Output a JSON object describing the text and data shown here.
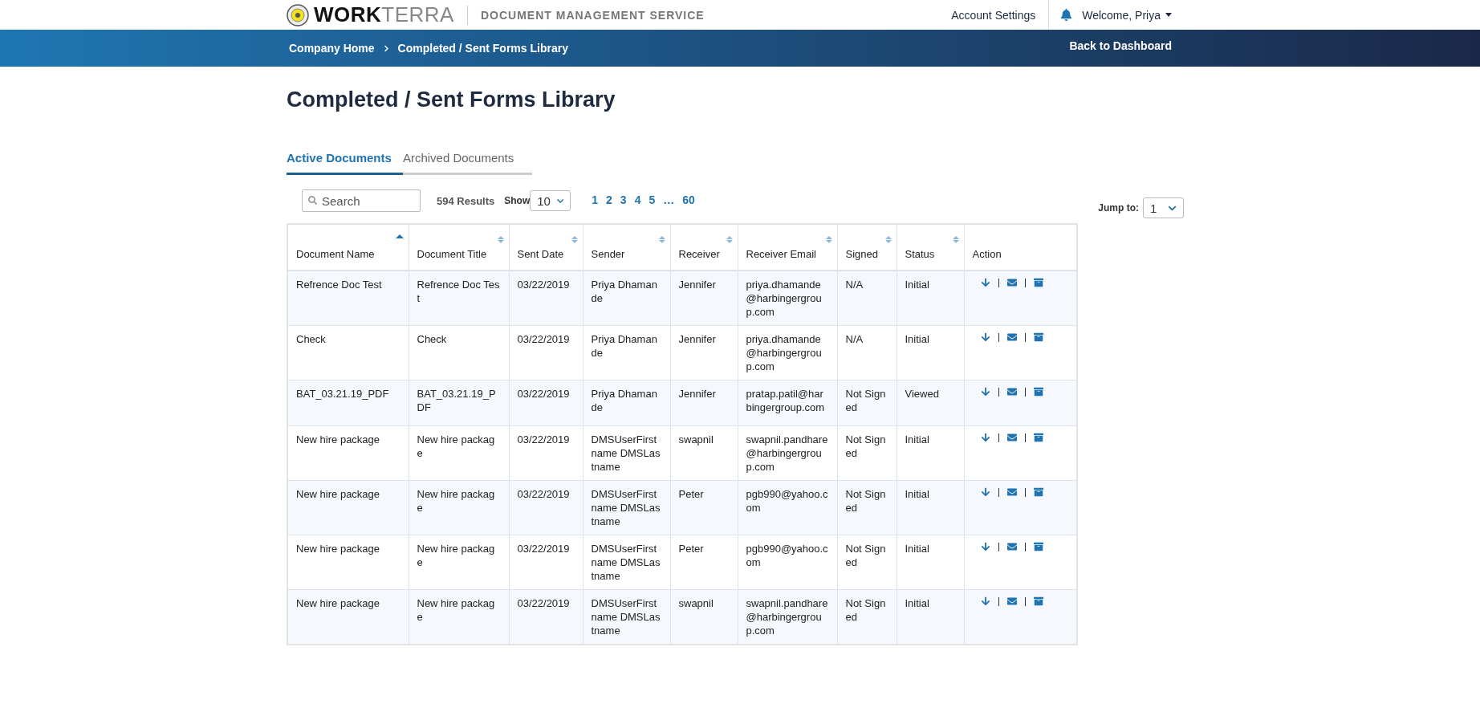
{
  "header": {
    "logo": "**WORK**TERRA",
    "service": "DOCUMENT MANAGEMENT SERVICE",
    "account_settings": "Account Settings",
    "welcome": "Welcome, Priya"
  },
  "breadcrumb": {
    "items": [
      "Company Home",
      "Completed / Sent Forms Library"
    ],
    "back": "Back to Dashboard"
  },
  "page_title": "Completed / Sent Forms Library",
  "tabs": [
    {
      "label": "Active Documents",
      "selected": true
    },
    {
      "label": "Archived Documents",
      "selected": false
    }
  ],
  "toolbar": {
    "search_placeholder": "Search",
    "results": "594 Results",
    "show_label": "Show",
    "show_value": "10",
    "pages": [
      "1",
      "2",
      "3",
      "4",
      "5",
      "…",
      "60"
    ],
    "jump_label": "Jump to:",
    "jump_value": "1"
  },
  "table": {
    "columns": [
      {
        "label": "Document Name",
        "sortable": true,
        "sorted": true
      },
      {
        "label": "Document Title",
        "sortable": true,
        "sorted": false
      },
      {
        "label": "Sent Date",
        "sortable": true,
        "sorted": false
      },
      {
        "label": "Sender",
        "sortable": true,
        "sorted": false
      },
      {
        "label": "Receiver",
        "sortable": true,
        "sorted": false
      },
      {
        "label": "Receiver Email",
        "sortable": true,
        "sorted": false
      },
      {
        "label": "Signed",
        "sortable": true,
        "sorted": false
      },
      {
        "label": "Status",
        "sortable": true,
        "sorted": false
      },
      {
        "label": "Action",
        "sortable": false
      }
    ],
    "rows": [
      [
        "Refrence Doc Test",
        "Refrence Doc Test",
        "03/22/2019",
        "Priya Dhamande",
        "Jennifer",
        "priya.dhamande@harbingergroup.com",
        "N/A",
        "Initial"
      ],
      [
        "Check",
        "Check",
        "03/22/2019",
        "Priya Dhamande",
        "Jennifer",
        "priya.dhamande@harbingergroup.com",
        "N/A",
        "Initial"
      ],
      [
        "BAT_03.21.19_PDF",
        "BAT_03.21.19_PDF",
        "03/22/2019",
        "Priya Dhamande",
        "Jennifer",
        "pratap.patil@harbingergroup.com",
        "Not Signed",
        "Viewed"
      ],
      [
        "New hire package",
        "New hire package",
        "03/22/2019",
        "DMSUserFirstname DMSLastname",
        "swapnil",
        "swapnil.pandhare@harbingergroup.com",
        "Not Signed",
        "Initial"
      ],
      [
        "New hire package",
        "New hire package",
        "03/22/2019",
        "DMSUserFirstname DMSLastname",
        "Peter",
        "pgb990@yahoo.com",
        "Not Signed",
        "Initial"
      ],
      [
        "New hire package",
        "New hire package",
        "03/22/2019",
        "DMSUserFirstname DMSLastname",
        "Peter",
        "pgb990@yahoo.com",
        "Not Signed",
        "Initial"
      ],
      [
        "New hire package",
        "New hire package",
        "03/22/2019",
        "DMSUserFirstname DMSLastname",
        "swapnil",
        "swapnil.pandhare@harbingergroup.com",
        "Not Signed",
        "Initial"
      ]
    ]
  }
}
